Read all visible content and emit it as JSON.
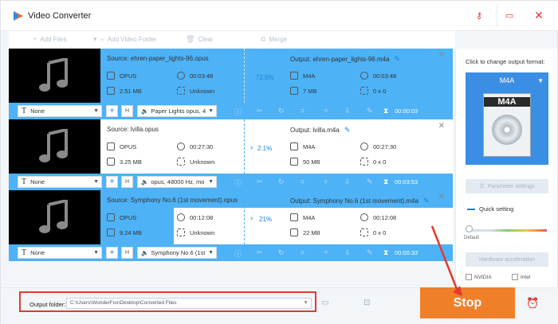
{
  "app": {
    "title": "Video Converter"
  },
  "toolbar": {
    "add_files": "Add Files",
    "add_video_folder": "Add Video Folder",
    "clear": "Clear",
    "merge": "Merge"
  },
  "tasks": [
    {
      "source_label": "Source: ehren-paper_lights-96.opus",
      "output_label": "Output: ehren-paper_lights-96.m4a",
      "src_format": "OPUS",
      "src_duration": "00:03:48",
      "src_size": "2.51 MB",
      "src_resolution": "Unknown",
      "progress": "72.5%",
      "out_format": "M4A",
      "out_duration": "00:03:48",
      "out_size": "7 MB",
      "out_resolution": "0 x 0",
      "subtitle": "None",
      "audio": "Paper Lights opus, 4",
      "time": "00:00:03"
    },
    {
      "source_label": "Source: lvilla.opus",
      "output_label": "Output: lvilla.m4a",
      "src_format": "OPUS",
      "src_duration": "00:27:30",
      "src_size": "3.25 MB",
      "src_resolution": "Unknown",
      "progress": "2.1%",
      "out_format": "M4A",
      "out_duration": "00:27:30",
      "out_size": "50 MB",
      "out_resolution": "0 x 0",
      "subtitle": "None",
      "audio": "opus, 48000 Hz, mo",
      "time": "00:03:53"
    },
    {
      "source_label": "Source: Symphony No.6 (1st movement).opus",
      "output_label": "Output: Symphony No.6 (1st movement).m4a",
      "src_format": "OPUS",
      "src_duration": "00:12:08",
      "src_size": "9.24 MB",
      "src_resolution": "Unknown",
      "progress": "21%",
      "out_format": "M4A",
      "out_duration": "00:12:08",
      "out_size": "22 MB",
      "out_resolution": "0 x 0",
      "subtitle": "None",
      "audio": "Symphony No.6 (1st",
      "time": "00:00:33"
    }
  ],
  "right_panel": {
    "change_format_label": "Click to change output format:",
    "format_name": "M4A",
    "format_icon_label": "M4A",
    "parameter_settings": "Parameter settings",
    "quick_setting": "Quick setting",
    "slider_default": "Default",
    "hardware_accel": "Hardware acceleration",
    "nvidia": "NVIDIA",
    "intel": "Intel"
  },
  "bottom": {
    "output_folder_label": "Output folder:",
    "output_folder_path": "C:\\Users\\WonderFox\\Desktop\\Converted Files",
    "stop": "Stop"
  },
  "colors": {
    "accent_blue": "#4db2f6",
    "stop_orange": "#f07f2a",
    "annotation_red": "#e23a2e"
  }
}
